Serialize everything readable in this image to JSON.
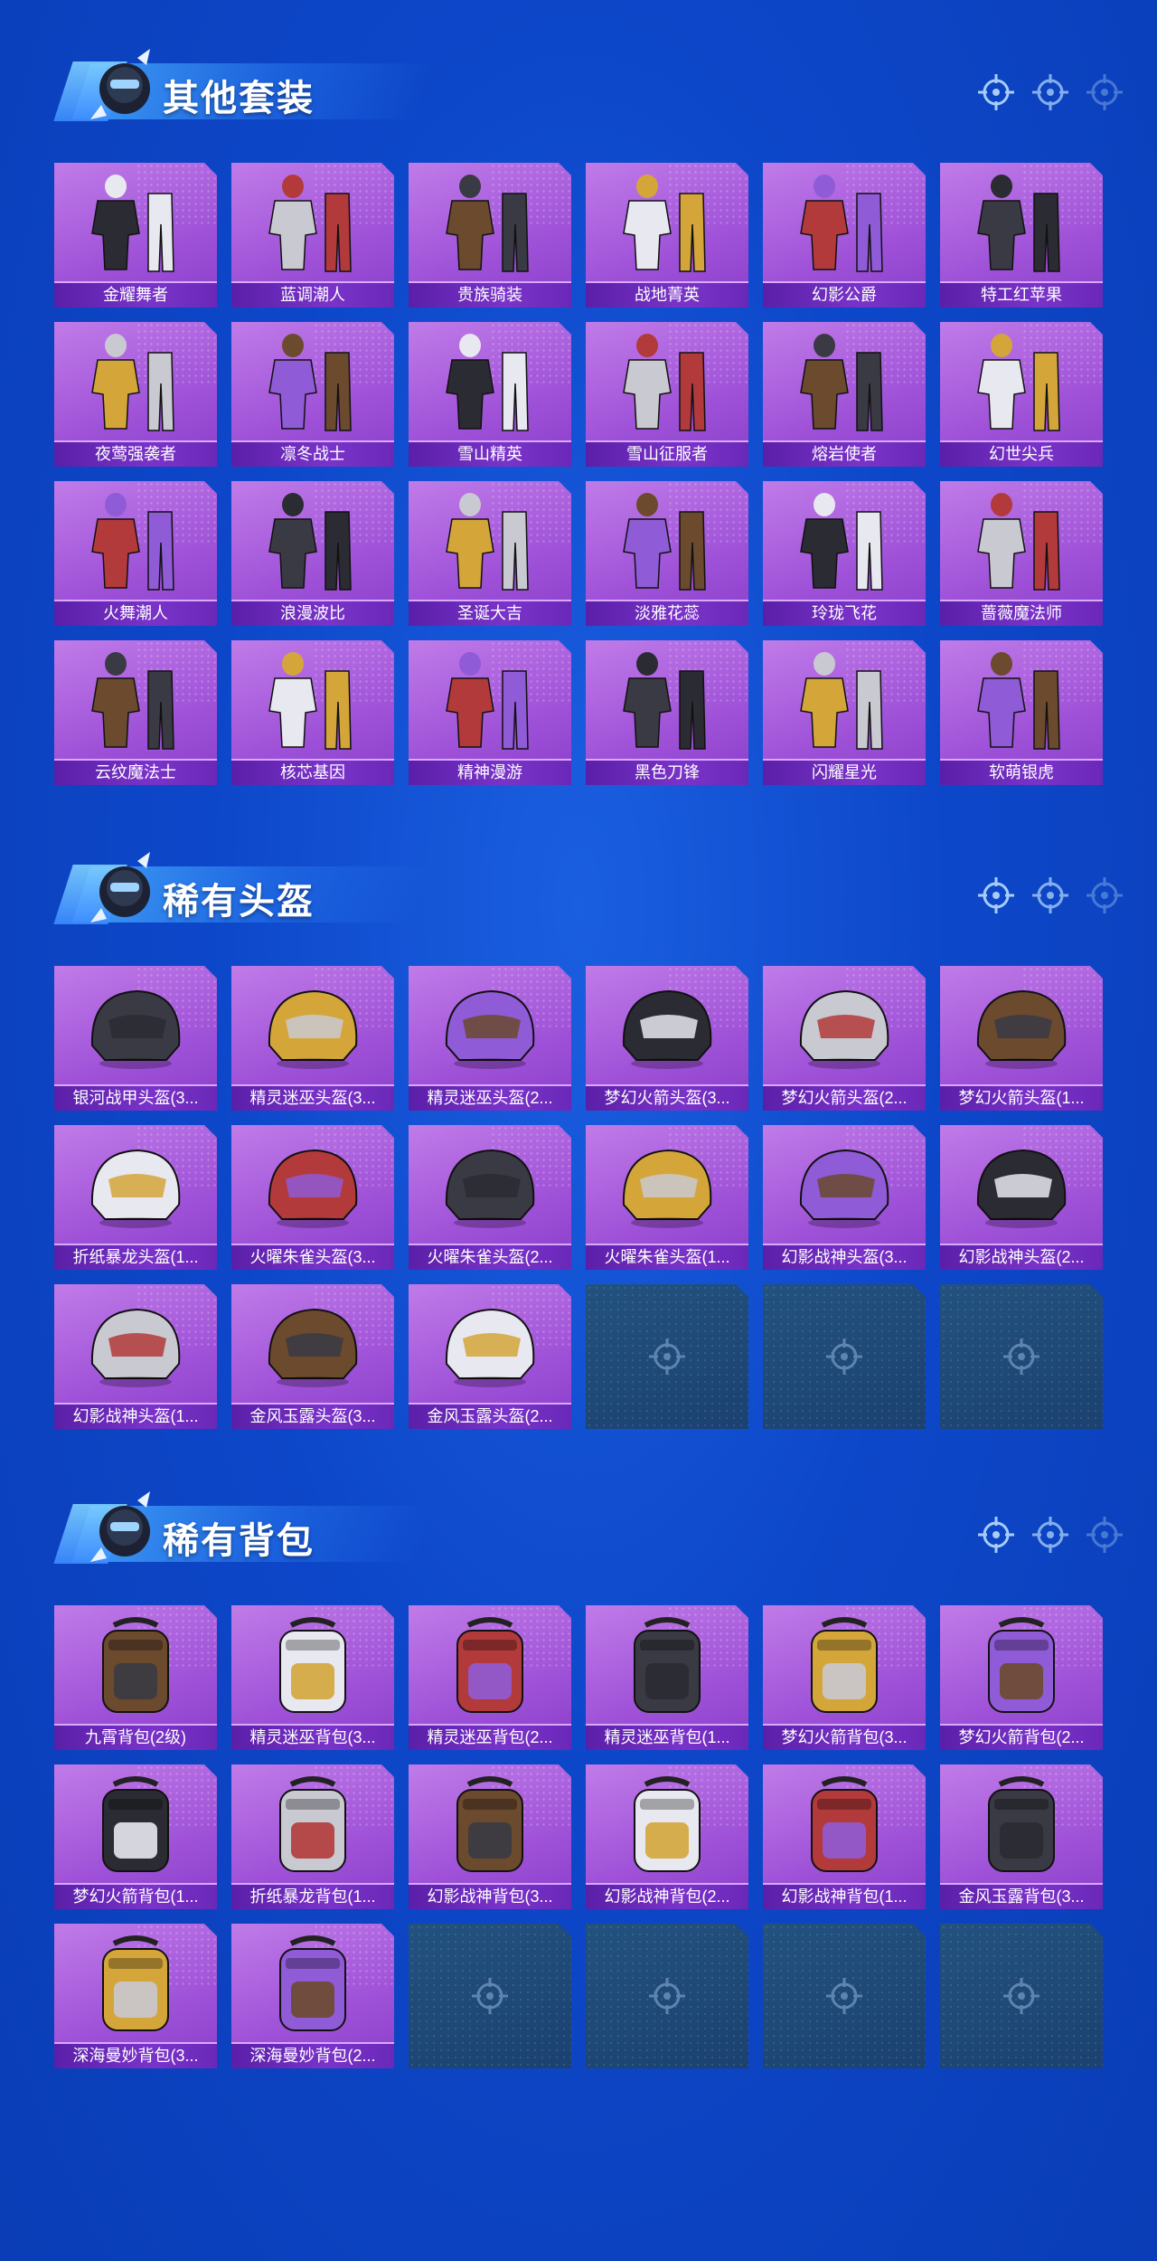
{
  "colors": {
    "background": "#0d47c9",
    "card": "#a95ddc",
    "card_label": "#6a28b8",
    "empty_slot": "#1f4a78"
  },
  "sections": [
    {
      "title": "其他套装",
      "items": [
        "金耀舞者",
        "蓝调潮人",
        "贵族骑装",
        "战地菁英",
        "幻影公爵",
        "特工红苹果",
        "夜莺强袭者",
        "凛冬战士",
        "雪山精英",
        "雪山征服者",
        "熔岩使者",
        "幻世尖兵",
        "火舞潮人",
        "浪漫波比",
        "圣诞大吉",
        "淡雅花蕊",
        "玲珑飞花",
        "蔷薇魔法师",
        "云纹魔法士",
        "核芯基因",
        "精神漫游",
        "黑色刀锋",
        "闪耀星光",
        "软萌银虎"
      ],
      "empty_slots": 0
    },
    {
      "title": "稀有头盔",
      "items": [
        "银河战甲头盔(3...",
        "精灵迷巫头盔(3...",
        "精灵迷巫头盔(2...",
        "梦幻火箭头盔(3...",
        "梦幻火箭头盔(2...",
        "梦幻火箭头盔(1...",
        "折纸暴龙头盔(1...",
        "火曜朱雀头盔(3...",
        "火曜朱雀头盔(2...",
        "火曜朱雀头盔(1...",
        "幻影战神头盔(3...",
        "幻影战神头盔(2...",
        "幻影战神头盔(1...",
        "金风玉露头盔(3...",
        "金风玉露头盔(2..."
      ],
      "empty_slots": 3
    },
    {
      "title": "稀有背包",
      "items": [
        "九霄背包(2级)",
        "精灵迷巫背包(3...",
        "精灵迷巫背包(2...",
        "精灵迷巫背包(1...",
        "梦幻火箭背包(3...",
        "梦幻火箭背包(2...",
        "梦幻火箭背包(1...",
        "折纸暴龙背包(1...",
        "幻影战神背包(3...",
        "幻影战神背包(2...",
        "幻影战神背包(1...",
        "金风玉露背包(3...",
        "深海曼妙背包(3...",
        "深海曼妙背包(2..."
      ],
      "empty_slots": 4
    }
  ]
}
